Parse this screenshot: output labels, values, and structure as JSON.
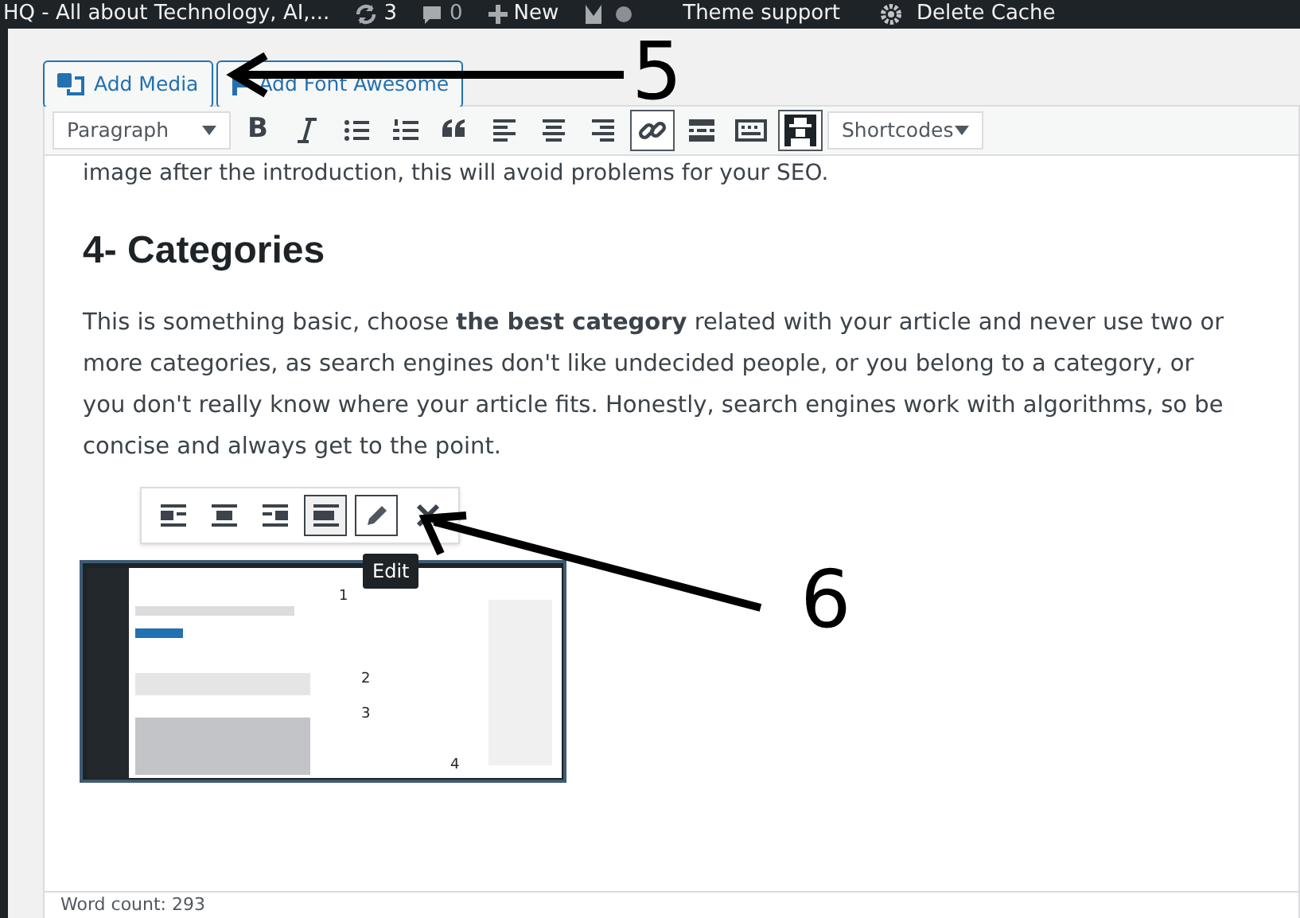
{
  "admin_bar": {
    "site_title": "HQ - All about Technology, AI,...",
    "updates": "3",
    "comments": "0",
    "new": "New",
    "theme_support": "Theme support",
    "delete_cache": "Delete Cache"
  },
  "media_buttons": [
    {
      "label": "Add Media",
      "kind": "media"
    },
    {
      "label": "Add Font Awesome",
      "kind": "flag"
    }
  ],
  "toolbar": {
    "format": "Paragraph",
    "buttons": [
      {
        "kind": "bold",
        "active": false,
        "label": "B"
      },
      {
        "kind": "italic",
        "active": false
      },
      {
        "kind": "bullets",
        "active": false
      },
      {
        "kind": "numbers",
        "active": false
      },
      {
        "kind": "quote",
        "active": false
      },
      {
        "kind": "align-left",
        "active": false
      },
      {
        "kind": "align-center",
        "active": false
      },
      {
        "kind": "align-right",
        "active": false
      },
      {
        "kind": "link",
        "active": true
      },
      {
        "kind": "more",
        "active": false
      },
      {
        "kind": "kitchen",
        "active": false
      },
      {
        "kind": "hat",
        "active": true
      }
    ],
    "shortcodes": "Shortcodes"
  },
  "content": {
    "cut_line": "image after the introduction, this will avoid problems for your SEO.",
    "heading": "4- Categories",
    "paragraph": "This is something basic, choose **the best category** related with your article and never use two or more categories, as search engines don't like undecided people, or you belong to a category, or you don't really know where your article fits. Honestly, search engines work with algorithms, so be concise and always get to the point."
  },
  "image_toolbar": [
    {
      "kind": "align-left",
      "selected": false
    },
    {
      "kind": "align-center",
      "selected": false
    },
    {
      "kind": "align-right",
      "selected": false
    },
    {
      "kind": "align-none",
      "selected": true
    },
    {
      "kind": "edit",
      "selected": false
    },
    {
      "kind": "remove",
      "selected": false
    }
  ],
  "tooltip": "Edit",
  "image_labels": [
    "1",
    "2",
    "3",
    "4"
  ],
  "annotations": [
    "5",
    "6"
  ],
  "word_count": "Word count: 293"
}
